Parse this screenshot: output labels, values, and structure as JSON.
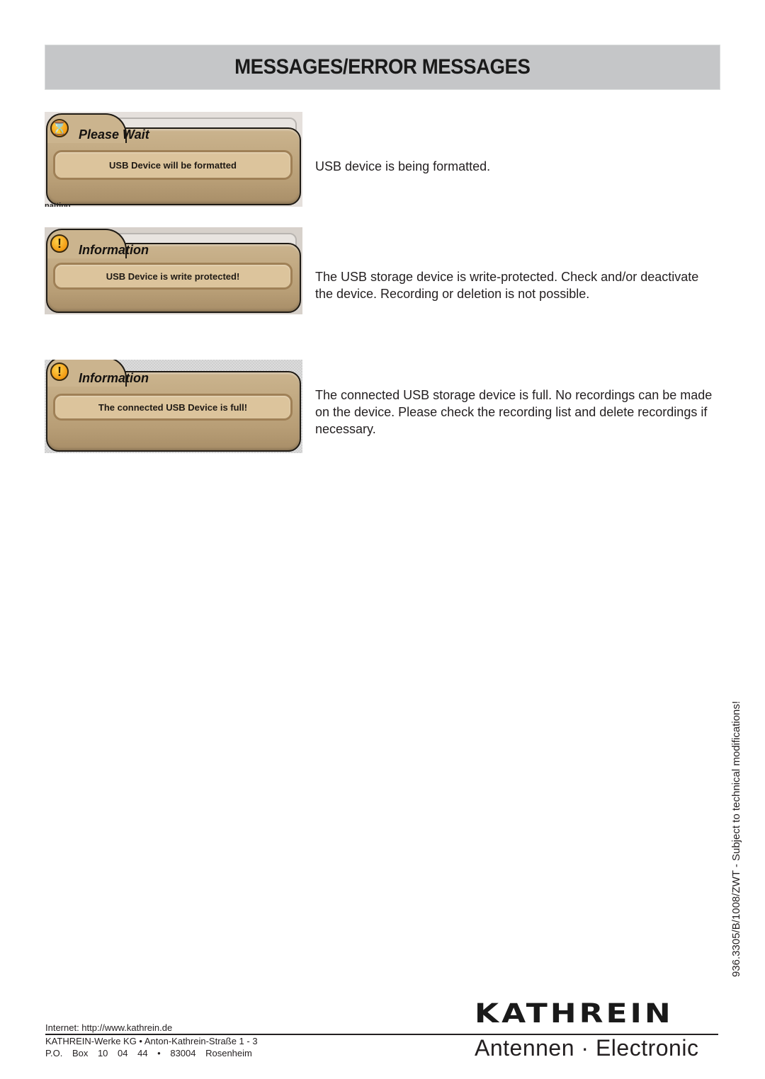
{
  "header": {
    "title": "MESSAGES/ERROR MESSAGES"
  },
  "messages": [
    {
      "icon": "hourglass-icon",
      "icon_glyph": "⌛",
      "dialog_title": "Please Wait",
      "dialog_text": "USB Device will be formatted",
      "background_fragment": "natting.",
      "description": "USB device is being formatted."
    },
    {
      "icon": "exclamation-icon",
      "icon_glyph": "!",
      "dialog_title": "Information",
      "dialog_text": "USB Device is write protected!",
      "description": "The USB storage device is write-protected. Check and/or deactivate the device. Recording or deletion is not possible."
    },
    {
      "icon": "exclamation-icon",
      "icon_glyph": "!",
      "dialog_title": "Information",
      "dialog_text": "The connected USB Device is full!",
      "description": "The connected USB storage device is full. No recordings can be made on the device. Please check the recording list and delete recordings if necessary."
    }
  ],
  "side_note": "936.3305/B/1008/ZWT - Subject to technical modifications!",
  "footer": {
    "internet": "Internet: http://www.kathrein.de",
    "address_line": "KATHREIN-Werke KG • Anton-Kathrein-Straße 1 - 3",
    "po_box_line": "P.O. Box 10 04 44 • 83004 Rosenheim",
    "logo": "KATHREIN",
    "tagline": "Antennen · Electronic"
  },
  "colors": {
    "header_bg": "#c5c6c8",
    "dialog_bg": "#b89e76",
    "dialog_message_bg": "#dcc49c",
    "icon_orange": "#f29a12"
  }
}
